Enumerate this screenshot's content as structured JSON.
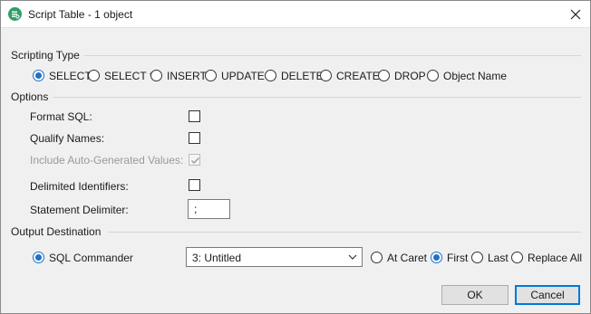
{
  "window": {
    "title": "Script Table - 1 object",
    "app_icon": "dbvis-app-icon",
    "close_icon": "close-icon"
  },
  "scripting_type": {
    "heading": "Scripting Type",
    "options": [
      "SELECT",
      "SELECT *",
      "INSERT",
      "UPDATE",
      "DELETE",
      "CREATE",
      "DROP",
      "Object Name"
    ],
    "selected": "SELECT"
  },
  "options": {
    "heading": "Options",
    "format_sql": {
      "label": "Format SQL:",
      "checked": false
    },
    "qualify_names": {
      "label": "Qualify Names:",
      "checked": false
    },
    "include_auto_generated": {
      "label": "Include Auto-Generated Values:",
      "checked": true,
      "disabled": true
    },
    "delimited_identifiers": {
      "label": "Delimited Identifiers:",
      "checked": false
    },
    "statement_delimiter": {
      "label": "Statement Delimiter:",
      "value": ";"
    }
  },
  "output_destination": {
    "heading": "Output Destination",
    "target": {
      "label": "SQL Commander",
      "checked": true
    },
    "editor_select": {
      "value": "3: Untitled"
    },
    "positions": [
      "At Caret",
      "First",
      "Last",
      "Replace All"
    ],
    "selected_position": "First"
  },
  "buttons": {
    "ok": "OK",
    "cancel": "Cancel"
  },
  "colors": {
    "accent": "#1f71c9",
    "app_icon": "#2e9e6a",
    "dialog_bg": "#f0f0f0"
  }
}
